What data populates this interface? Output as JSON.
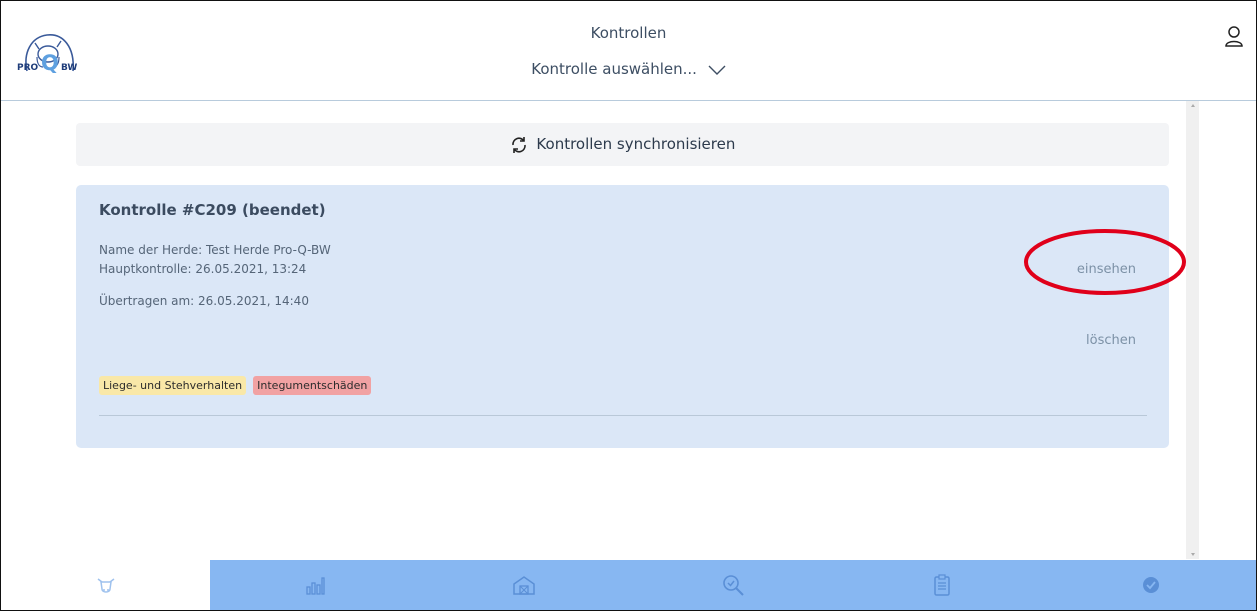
{
  "header": {
    "logo": {
      "left_text": "PRO",
      "q_text": "Q",
      "right_text": "BW"
    },
    "title": "Kontrollen",
    "selector_label": "Kontrolle auswählen...",
    "icons": {
      "dropdown": "chevron-down-icon",
      "user": "user-icon"
    }
  },
  "sync": {
    "label": "Kontrollen synchronisieren",
    "icon": "refresh-icon"
  },
  "card": {
    "title": "Kontrolle #C209 (beendet)",
    "herd_line": "Name der Herde: Test Herde Pro-Q-BW",
    "main_line": "Hauptkontrolle: 26.05.2021, 13:24",
    "transfer_line": "Übertragen am: 26.05.2021, 14:40",
    "view_label": "einsehen",
    "delete_label": "löschen",
    "tags": [
      {
        "label": "Liege- und Stehverhalten",
        "color": "#f9e8a8"
      },
      {
        "label": "Integumentschäden",
        "color": "#f1a2a3"
      }
    ]
  },
  "annotation": {
    "color": "#e0001a"
  },
  "bottom_nav": {
    "active_index": 0,
    "items": [
      {
        "icon": "cow-icon"
      },
      {
        "icon": "bar-chart-icon"
      },
      {
        "icon": "barn-icon"
      },
      {
        "icon": "search-check-icon"
      },
      {
        "icon": "clipboard-icon"
      },
      {
        "icon": "check-circle-icon"
      }
    ]
  },
  "colors": {
    "accent": "#87b7f2",
    "card_bg": "#dbe7f7",
    "text": "#3b4b60"
  }
}
